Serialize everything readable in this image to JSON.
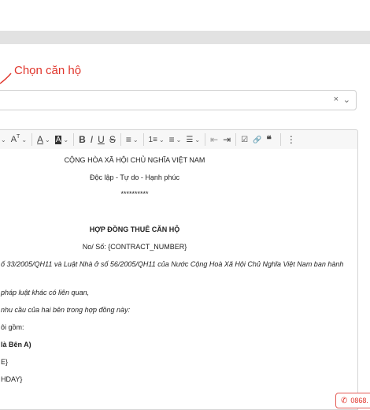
{
  "annotation": {
    "text": "Chọn căn hộ"
  },
  "select": {
    "clear_icon": "×",
    "caret_icon": "⌄"
  },
  "toolbar": {
    "font_size": "A",
    "heading": "A",
    "text_color": "A",
    "bg_color": "A",
    "bold": "B",
    "italic": "I",
    "underline": "U",
    "strike": "S",
    "align": "≡",
    "ordered": "1≡",
    "bullet": "≡",
    "check": "☰",
    "outdent": "⇤",
    "indent": "⇥",
    "task": "☑",
    "link": "🔗",
    "quote": "❝",
    "more": "⋮"
  },
  "document": {
    "nation": "CỘNG HÒA XÃ HỘI CHỦ NGHĨA VIỆT NAM",
    "motto": "Độc lập - Tự do - Hạnh phúc",
    "stars": "**********",
    "title": "HỢP ĐỒNG THUÊ CĂN HỘ",
    "number": "No/ Số: {CONTRACT_NUMBER}",
    "law": "ố 33/2005/QH11 và Luật Nhà ở số 56/2005/QH11 của Nước Cộng Hoà Xã Hội Chủ Nghĩa Việt Nam ban hành",
    "related": "pháp luật khác có liên quan,",
    "needs": "nhu cầu của hai bên trong hợp đồng này:",
    "parties": "ôi gồm:",
    "party_a": "là Bên A)",
    "field1": "E}",
    "field2": "HDAY}"
  },
  "phone": {
    "number": "0868."
  }
}
